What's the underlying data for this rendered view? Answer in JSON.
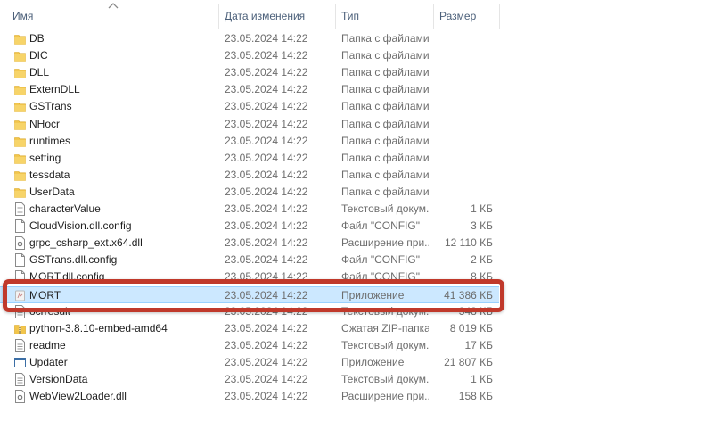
{
  "header": {
    "name": "Имя",
    "date": "Дата изменения",
    "type": "Тип",
    "size": "Размер"
  },
  "rows": [
    {
      "name": "DB",
      "date": "23.05.2024 14:22",
      "type": "Папка с файлами",
      "size": "",
      "icon": "folder-icon"
    },
    {
      "name": "DIC",
      "date": "23.05.2024 14:22",
      "type": "Папка с файлами",
      "size": "",
      "icon": "folder-icon"
    },
    {
      "name": "DLL",
      "date": "23.05.2024 14:22",
      "type": "Папка с файлами",
      "size": "",
      "icon": "folder-icon"
    },
    {
      "name": "ExternDLL",
      "date": "23.05.2024 14:22",
      "type": "Папка с файлами",
      "size": "",
      "icon": "folder-icon"
    },
    {
      "name": "GSTrans",
      "date": "23.05.2024 14:22",
      "type": "Папка с файлами",
      "size": "",
      "icon": "folder-icon"
    },
    {
      "name": "NHocr",
      "date": "23.05.2024 14:22",
      "type": "Папка с файлами",
      "size": "",
      "icon": "folder-icon"
    },
    {
      "name": "runtimes",
      "date": "23.05.2024 14:22",
      "type": "Папка с файлами",
      "size": "",
      "icon": "folder-icon"
    },
    {
      "name": "setting",
      "date": "23.05.2024 14:22",
      "type": "Папка с файлами",
      "size": "",
      "icon": "folder-icon"
    },
    {
      "name": "tessdata",
      "date": "23.05.2024 14:22",
      "type": "Папка с файлами",
      "size": "",
      "icon": "folder-icon"
    },
    {
      "name": "UserData",
      "date": "23.05.2024 14:22",
      "type": "Папка с файлами",
      "size": "",
      "icon": "folder-icon"
    },
    {
      "name": "characterValue",
      "date": "23.05.2024 14:22",
      "type": "Текстовый докум...",
      "size": "1 КБ",
      "icon": "text-file-icon"
    },
    {
      "name": "CloudVision.dll.config",
      "date": "23.05.2024 14:22",
      "type": "Файл \"CONFIG\"",
      "size": "3 КБ",
      "icon": "file-icon"
    },
    {
      "name": "grpc_csharp_ext.x64.dll",
      "date": "23.05.2024 14:22",
      "type": "Расширение при...",
      "size": "12 110 КБ",
      "icon": "dll-file-icon"
    },
    {
      "name": "GSTrans.dll.config",
      "date": "23.05.2024 14:22",
      "type": "Файл \"CONFIG\"",
      "size": "2 КБ",
      "icon": "file-icon"
    },
    {
      "name": "MORT.dll.config",
      "date": "23.05.2024 14:22",
      "type": "Файл \"CONFIG\"",
      "size": "8 КБ",
      "icon": "file-icon"
    },
    {
      "name": "MORT",
      "date": "23.05.2024 14:22",
      "type": "Приложение",
      "size": "41 386 КБ",
      "icon": "app-icon",
      "selected": true
    },
    {
      "name": "ocrresult",
      "date": "23.05.2024 14:22",
      "type": "Текстовый докум...",
      "size": "348 КБ",
      "icon": "text-file-icon"
    },
    {
      "name": "python-3.8.10-embed-amd64",
      "date": "23.05.2024 14:22",
      "type": "Сжатая ZIP-папка",
      "size": "8 019 КБ",
      "icon": "zip-folder-icon"
    },
    {
      "name": "readme",
      "date": "23.05.2024 14:22",
      "type": "Текстовый докум...",
      "size": "17 КБ",
      "icon": "text-file-icon"
    },
    {
      "name": "Updater",
      "date": "23.05.2024 14:22",
      "type": "Приложение",
      "size": "21 807 КБ",
      "icon": "app-window-icon"
    },
    {
      "name": "VersionData",
      "date": "23.05.2024 14:22",
      "type": "Текстовый докум...",
      "size": "1 КБ",
      "icon": "text-file-icon"
    },
    {
      "name": "WebView2Loader.dll",
      "date": "23.05.2024 14:22",
      "type": "Расширение при...",
      "size": "158 КБ",
      "icon": "dll-file-icon"
    }
  ],
  "colors": {
    "folder": "#f2c54b",
    "selection": "#cce8ff",
    "highlight_border": "#c0392b",
    "header_text": "#4c607a"
  }
}
